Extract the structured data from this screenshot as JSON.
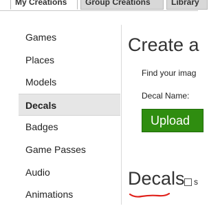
{
  "tabs": [
    {
      "label": "My Creations"
    },
    {
      "label": "Group Creations"
    },
    {
      "label": "Library"
    }
  ],
  "sidebar": {
    "items": [
      {
        "label": "Games"
      },
      {
        "label": "Places"
      },
      {
        "label": "Models"
      },
      {
        "label": "Decals"
      },
      {
        "label": "Badges"
      },
      {
        "label": "Game Passes"
      },
      {
        "label": "Audio"
      },
      {
        "label": "Animations"
      }
    ],
    "selected": "Decals"
  },
  "main": {
    "heading": "Create a",
    "find_text": "Find your imag",
    "decal_name_label": "Decal Name:",
    "upload_label": "Upload",
    "section_title": "Decals",
    "checkbox_label": "s"
  },
  "colors": {
    "upload_button": "#2f8d10",
    "annotation_underline": "#e0201a"
  }
}
